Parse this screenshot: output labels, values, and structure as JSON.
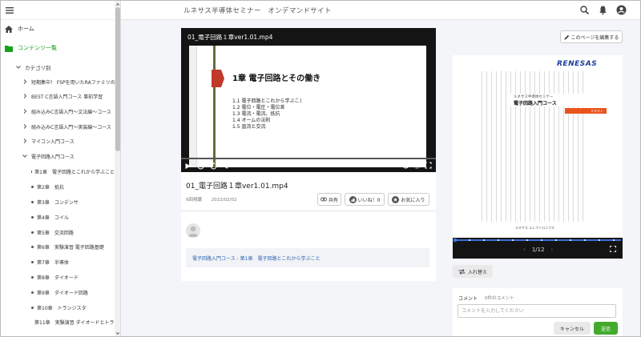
{
  "header": {
    "site_title": "ルネサス半導体セミナー　オンデマンドサイト"
  },
  "sidebar": {
    "nav": [
      {
        "label": "ホーム"
      },
      {
        "label": "コンテンツ一覧"
      }
    ],
    "category_label": "カテゴリ別",
    "categories": [
      {
        "label": "短期集中！ FSPを用いたRAファミリのI..."
      },
      {
        "label": "BEST C言語入門コース 事前学習"
      },
      {
        "label": "組み込みC言語入門〜文法編〜コース"
      },
      {
        "label": "組み込みC言語入門〜実装編〜コース"
      },
      {
        "label": "マイコン入門コース"
      },
      {
        "label": "電子回路入門コース"
      }
    ],
    "chapters": [
      {
        "label": "第1章　電子回路とこれから学ぶこと"
      },
      {
        "label": "第2章　抵抗"
      },
      {
        "label": "第3章　コンデンサ"
      },
      {
        "label": "第4章　コイル"
      },
      {
        "label": "第5章　交流回路"
      },
      {
        "label": "第6章　実験演習 電子回路基礎"
      },
      {
        "label": "第7章　半導体"
      },
      {
        "label": "第8章　ダイオード"
      },
      {
        "label": "第9章　ダイオード回路"
      },
      {
        "label": "第10章　トランジスタ"
      },
      {
        "label": "第11章　実験演習 ダイオードとトラ..."
      }
    ]
  },
  "video": {
    "overlay_title": "01_電子回路１章ver1.01.mp4",
    "slide_heading": "1章  電子回路とその働き",
    "slide_items": [
      "1.1  電子回路とこれから学ぶこと",
      "1.2  電位・電圧・電位差",
      "1.3  電流・電流、抵抗",
      "1.4  オームの法則",
      "1.5  直流と交流"
    ],
    "time": "00:00:00/00:25:35",
    "progress": 0
  },
  "content": {
    "title": "01_電子回路１章ver1.01.mp4",
    "views": "9回視聴",
    "date": "2022/02/02",
    "share_label": "共有",
    "like_label": "いいね！0",
    "favorite_label": "お気に入り",
    "breadcrumb": "電子回路入門コース - 第1章　電子回路とこれから学ぶこと"
  },
  "document": {
    "edit_button": "このページを編集する",
    "logo": "RENESAS",
    "cover_subtitle": "ルネサス半導体セミナー",
    "cover_title": "電子回路入門コース",
    "cover_tag": "テキスト",
    "cover_footer": "ルネサス エレクトロニクス",
    "page_current": "1",
    "page_total": "12",
    "page_display": "1/12",
    "swap_label": "入れ替え"
  },
  "comment": {
    "label": "コメント",
    "count": "0件のコメント",
    "placeholder": "コメントを入力してください",
    "cancel_label": "キャンセル",
    "send_label": "送信"
  },
  "colors": {
    "accent_green": "#19a01c",
    "send_green": "#43ab2c",
    "link_blue": "#2c63b6",
    "renesas_blue": "#1a3e9a"
  }
}
